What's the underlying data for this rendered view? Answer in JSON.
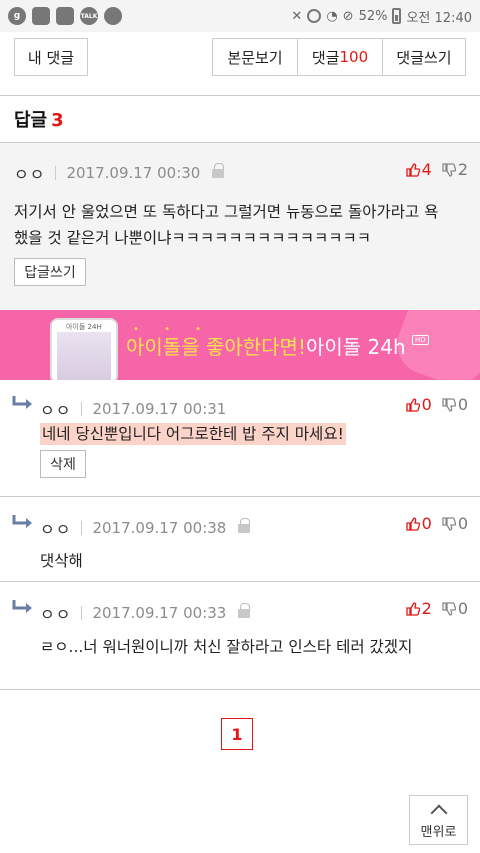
{
  "statusbar": {
    "left_icons": [
      "g",
      "",
      "",
      "TALK",
      ""
    ],
    "battery": "52%",
    "time": "오전 12:40"
  },
  "toolbar": {
    "my_comments": "내 댓글",
    "view_post": "본문보기",
    "comments_label": "댓글",
    "comments_count": "100",
    "write_comment": "댓글쓰기"
  },
  "replies": {
    "label": "답글",
    "count": "3"
  },
  "parent_comment": {
    "nick": "ㅇㅇ",
    "date": "2017.09.17 00:30",
    "up": "4",
    "down": "2",
    "text_line1": "저기서 안 울었으면 또 독하다고 그럴거면 뉴동으로 돌아가라고 욕",
    "text_line2": "했을 것 같은거 나뿐이냐ㅋㅋㅋㅋㅋㅋㅋㅋㅋㅋㅋㅋㅋㅋ",
    "reply_button": "답글쓰기"
  },
  "banner": {
    "phone_title": "아이돌 24H",
    "text_main": "아이돌을 좋아한다면!",
    "text_brand": "아이돌 24h",
    "hd": "HD",
    "dots": "• • •"
  },
  "reply_comments": [
    {
      "nick": "ㅇㅇ",
      "date": "2017.09.17 00:31",
      "up": "0",
      "down": "0",
      "text": "네네 당신뿐입니다 어그로한테 밥 주지 마세요!",
      "delete_button": "삭제"
    },
    {
      "nick": "ㅇㅇ",
      "date": "2017.09.17 00:38",
      "up": "0",
      "down": "0",
      "text": "댓삭해"
    },
    {
      "nick": "ㅇㅇ",
      "date": "2017.09.17 00:33",
      "up": "2",
      "down": "0",
      "text": "ㄹㅇ...너 워너원이니까 처신 잘하라고 인스타 테러 갔겠지"
    }
  ],
  "pagination": {
    "current": "1"
  },
  "scroll_top": {
    "label": "맨위로"
  },
  "colors": {
    "accent": "#e51515",
    "banner_bg": "#f765a9",
    "highlight": "#fcd3c9"
  }
}
